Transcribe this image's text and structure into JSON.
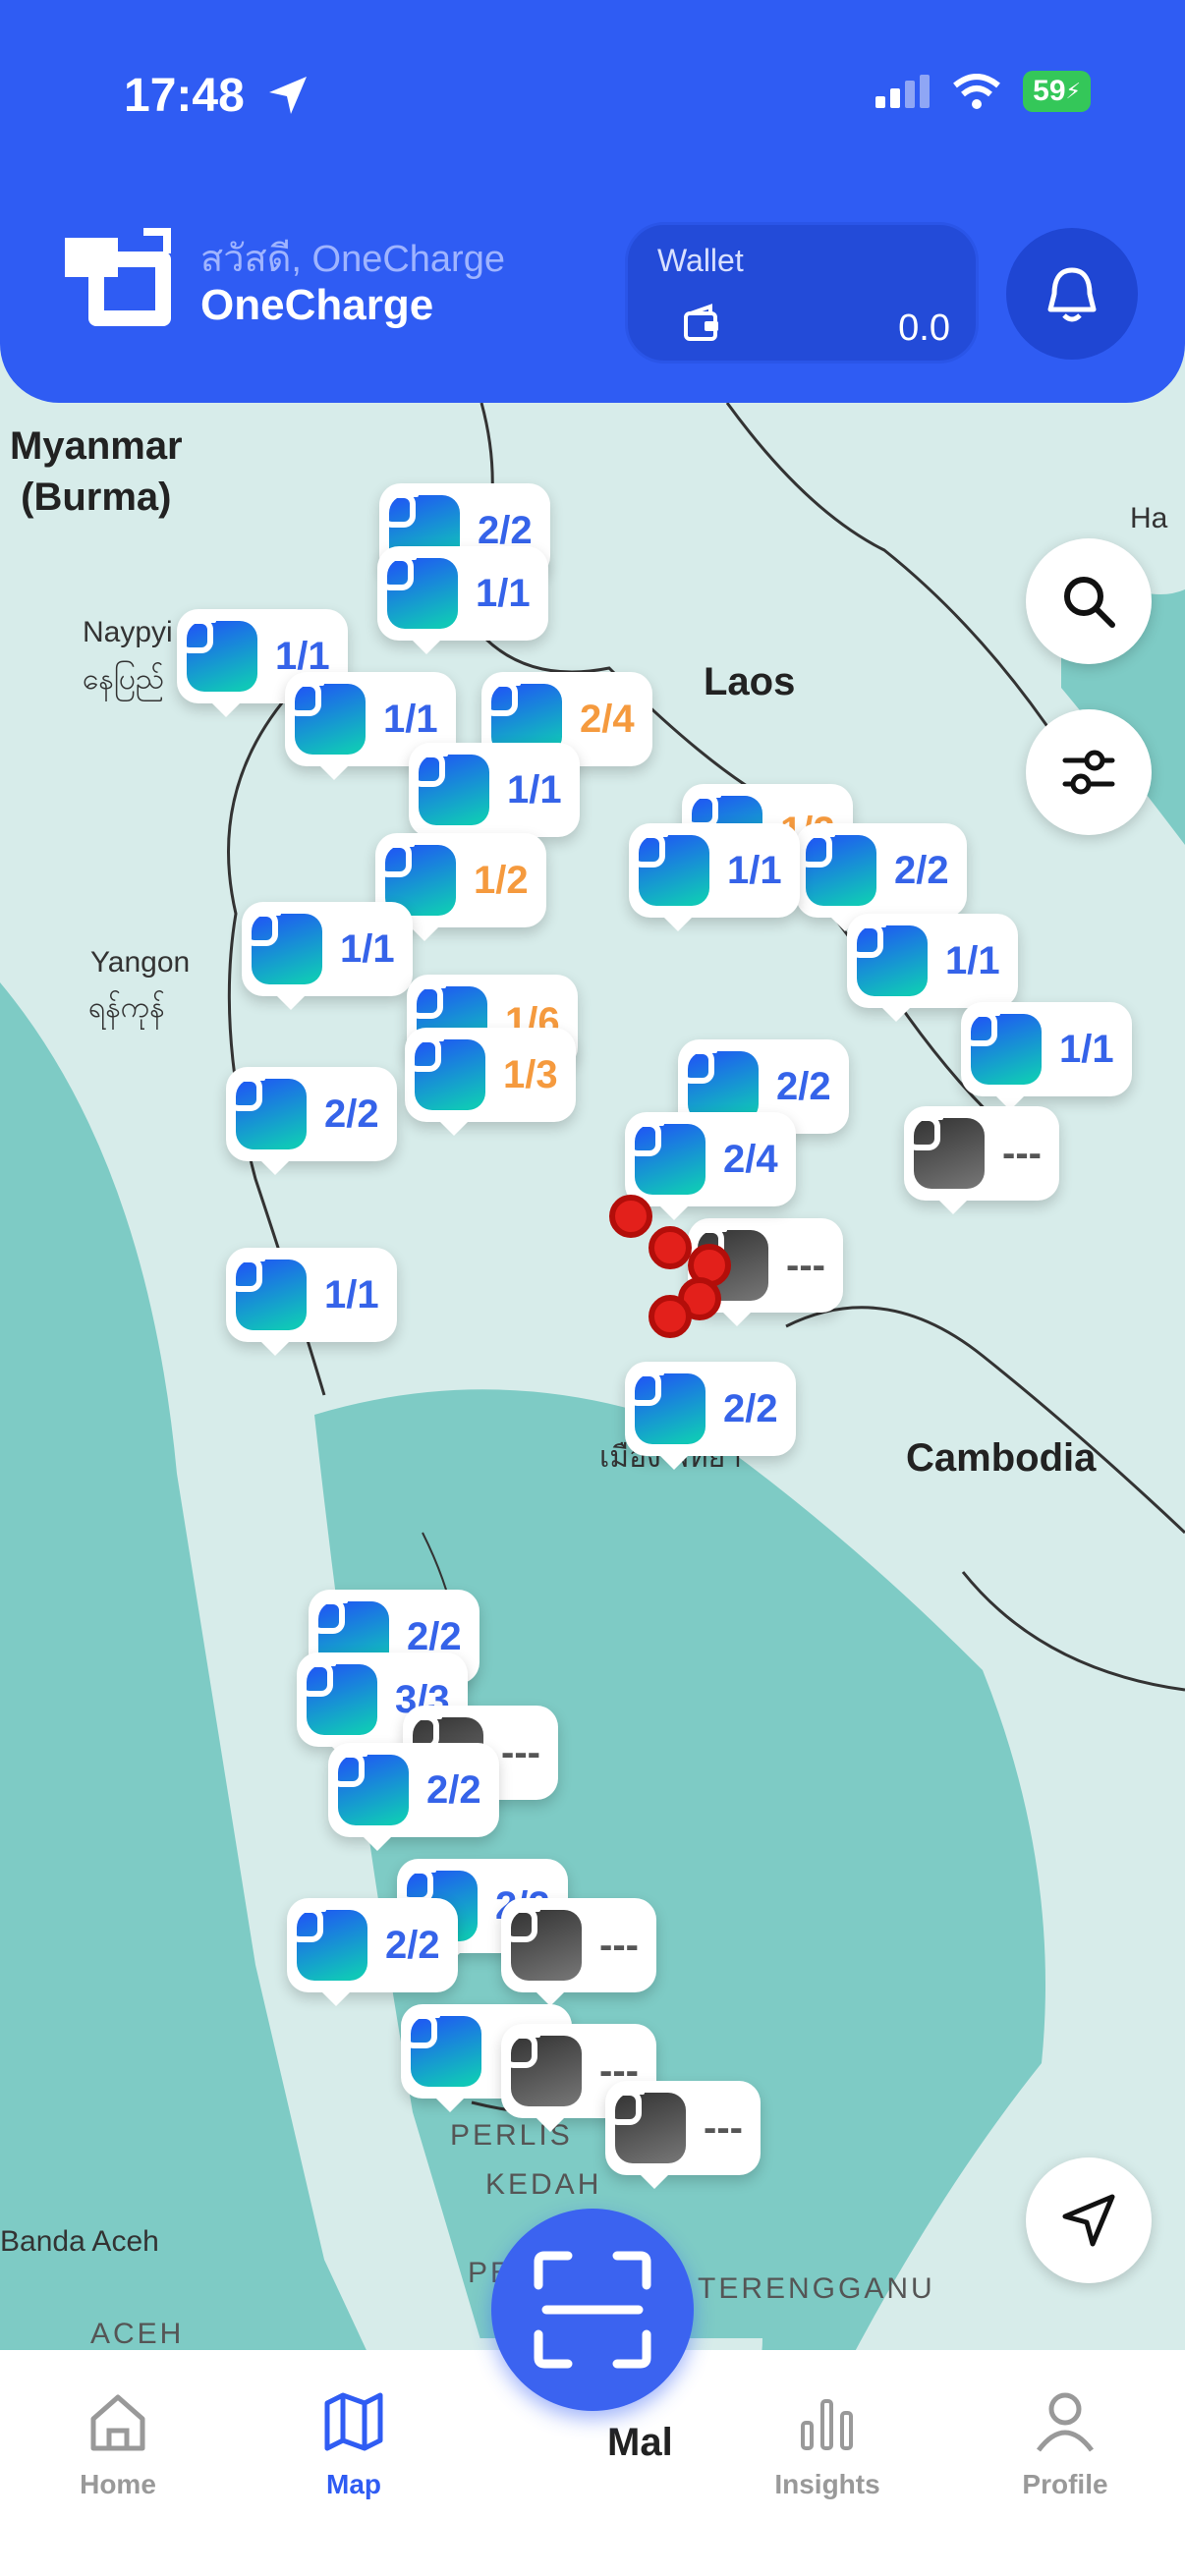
{
  "status": {
    "time": "17:48",
    "battery": "59"
  },
  "header": {
    "greeting": "สวัสดี, OneCharge",
    "brand": "OneCharge",
    "wallet_label": "Wallet",
    "wallet_amount": "0.0"
  },
  "map": {
    "places": {
      "myanmar": "Myanmar\n(Burma)",
      "laos": "Laos",
      "cambodia": "Cambodia",
      "naypyitaw": "Naypyi",
      "naypyitaw_local": "နေပြည်",
      "yangon": "Yangon",
      "yangon_local": "ရန်ကုန်",
      "hanoi": "Ha",
      "banda_aceh": "Banda Aceh",
      "aceh": "ACEH",
      "perlis": "PERLIS",
      "kedah": "KEDAH",
      "terengganu": "TERENGGANU",
      "pattaya": "เมือง พัทยา",
      "malaysia": "Mal",
      "pe": "PE"
    },
    "markers": [
      {
        "label": "2/2"
      },
      {
        "label": "1/1"
      },
      {
        "label": "1/1"
      },
      {
        "label": "1/1"
      },
      {
        "label": "2/4"
      },
      {
        "label": "1/1"
      },
      {
        "label": "1/2"
      },
      {
        "label": "1/2"
      },
      {
        "label": "2/2"
      },
      {
        "label": "1/1"
      },
      {
        "label": "1/1"
      },
      {
        "label": "1/1"
      },
      {
        "label": "1/6"
      },
      {
        "label": "1/3"
      },
      {
        "label": "2/2"
      },
      {
        "label": "1/1"
      },
      {
        "label": "---"
      },
      {
        "label": "---"
      },
      {
        "label": "2/2"
      },
      {
        "label": "2/2"
      },
      {
        "label": "3/3"
      },
      {
        "label": "---"
      },
      {
        "label": "2/2"
      },
      {
        "label": "2/2"
      },
      {
        "label": "2/2"
      },
      {
        "label": "---"
      },
      {
        "label": "1/1"
      },
      {
        "label": "---"
      },
      {
        "label": "---"
      },
      {
        "label": "2/2"
      },
      {
        "label": "2/4"
      },
      {
        "label": "1/1"
      }
    ]
  },
  "nav": {
    "home": "Home",
    "map": "Map",
    "insights": "Insights",
    "profile": "Profile"
  }
}
